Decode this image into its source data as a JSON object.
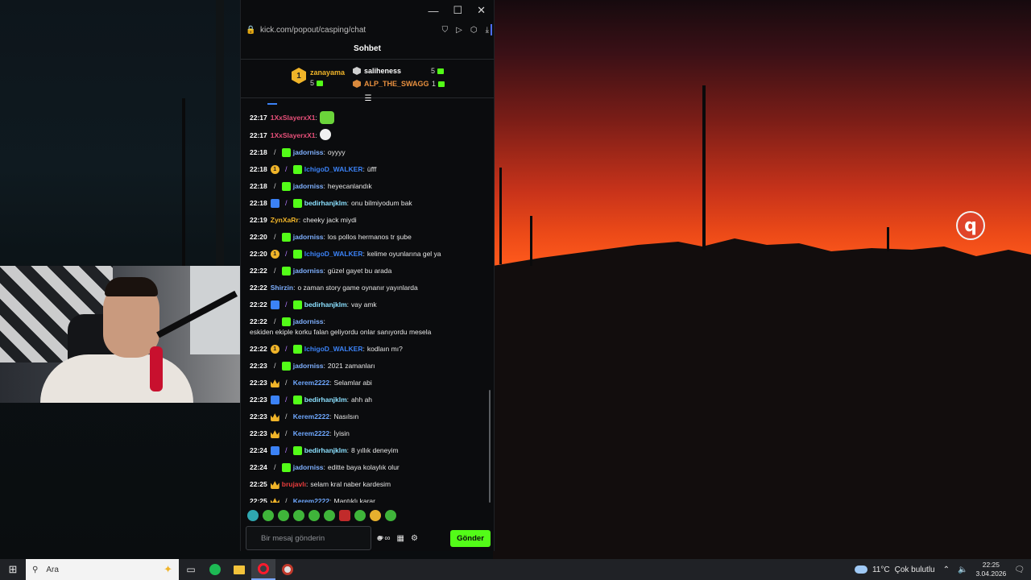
{
  "browser": {
    "url": "kick.com/popout/casping/chat"
  },
  "chat": {
    "title": "Sohbet",
    "leaderboard": [
      {
        "rank": "1",
        "name": "zanayama",
        "count": "5"
      },
      {
        "name": "saliheness",
        "count": "5"
      },
      {
        "name": "ALP_THE_SWAGG",
        "count": "1"
      }
    ],
    "messages": [
      {
        "time": "22:17",
        "user": "1XxSlayerxX1",
        "color": "#e8507a",
        "text": "",
        "emote": "green"
      },
      {
        "time": "22:17",
        "user": "1XxSlayerxX1",
        "color": "#e8507a",
        "text": "",
        "emote": "white"
      },
      {
        "time": "22:18",
        "badges": [
          "pen",
          "sub"
        ],
        "user": "jadorniss",
        "color": "#7fb0ff",
        "text": "oyyyy"
      },
      {
        "time": "22:18",
        "badges": [
          "coin",
          "pen-purple",
          "sub"
        ],
        "user": "IchigoD_WALKER",
        "color": "#3b82f6",
        "text": "üfff"
      },
      {
        "time": "22:18",
        "badges": [
          "pen",
          "sub"
        ],
        "user": "jadorniss",
        "color": "#7fb0ff",
        "text": "heyecanlandık"
      },
      {
        "time": "22:18",
        "badges": [
          "blue",
          "pen-purple",
          "sub"
        ],
        "user": "bedirhanjklm",
        "color": "#8be0ff",
        "text": "onu bilmiyodum bak"
      },
      {
        "time": "22:19",
        "badges": [],
        "user": "ZynXaRr",
        "color": "#f0b429",
        "text": "cheeky jack miydi"
      },
      {
        "time": "22:20",
        "badges": [
          "pen",
          "sub"
        ],
        "user": "jadorniss",
        "color": "#7fb0ff",
        "text": "los pollos hermanos tr şube"
      },
      {
        "time": "22:20",
        "badges": [
          "coin",
          "pen-purple",
          "sub"
        ],
        "user": "IchigoD_WALKER",
        "color": "#3b82f6",
        "text": "kelime oyunlarına gel ya"
      },
      {
        "time": "22:22",
        "badges": [
          "pen",
          "sub"
        ],
        "user": "jadorniss",
        "color": "#7fb0ff",
        "text": "güzel gayet bu arada"
      },
      {
        "time": "22:22",
        "badges": [],
        "user": "Shirzin",
        "color": "#7fb0ff",
        "text": "o zaman story game oynanır yayınlarda"
      },
      {
        "time": "22:22",
        "badges": [
          "blue",
          "pen-purple",
          "sub"
        ],
        "user": "bedirhanjklm",
        "color": "#8be0ff",
        "text": "vay amk"
      },
      {
        "time": "22:22",
        "badges": [
          "pen",
          "sub"
        ],
        "user": "jadorniss",
        "color": "#7fb0ff",
        "text": "eskiden ekiple korku falan geliyordu onlar sanıyordu mesela"
      },
      {
        "time": "22:22",
        "badges": [
          "coin",
          "pen-purple",
          "sub"
        ],
        "user": "IchigoD_WALKER",
        "color": "#3b82f6",
        "text": "kodlaın mı?"
      },
      {
        "time": "22:23",
        "badges": [
          "pen",
          "sub"
        ],
        "user": "jadorniss",
        "color": "#7fb0ff",
        "text": "2021 zamanları"
      },
      {
        "time": "22:23",
        "badges": [
          "crown",
          "pen"
        ],
        "user": "Kerem2222",
        "color": "#6fa8ff",
        "text": "Selamlar abi"
      },
      {
        "time": "22:23",
        "badges": [
          "blue",
          "pen-purple",
          "sub"
        ],
        "user": "bedirhanjklm",
        "color": "#8be0ff",
        "text": "ahh ah"
      },
      {
        "time": "22:23",
        "badges": [
          "crown",
          "pen"
        ],
        "user": "Kerem2222",
        "color": "#6fa8ff",
        "text": "Nasılsın"
      },
      {
        "time": "22:23",
        "badges": [
          "crown",
          "pen"
        ],
        "user": "Kerem2222",
        "color": "#6fa8ff",
        "text": "İyisin"
      },
      {
        "time": "22:24",
        "badges": [
          "blue",
          "pen-purple",
          "sub"
        ],
        "user": "bedirhanjklm",
        "color": "#8be0ff",
        "text": "8 yıllık deneyim"
      },
      {
        "time": "22:24",
        "badges": [
          "pen",
          "sub"
        ],
        "user": "jadorniss",
        "color": "#7fb0ff",
        "text": "editte baya kolaylık olur"
      },
      {
        "time": "22:25",
        "badges": [
          "crown"
        ],
        "user": "brujavlı",
        "color": "#e83c3c",
        "text": "selam kral naber kardesim"
      },
      {
        "time": "22:25",
        "badges": [
          "crown",
          "pen"
        ],
        "user": "Kerem2222",
        "color": "#6fa8ff",
        "text": "Mantıklı karar"
      }
    ],
    "input": {
      "placeholder": "Bir mesaj gönderin",
      "value": ""
    },
    "send_label": "Gönder"
  },
  "taskbar": {
    "search_placeholder": "Ara",
    "weather_temp": "11°C",
    "weather_desc": "Çok bulutlu",
    "time": "22:25",
    "date": "3.04.2026"
  },
  "colors": {
    "accent": "#53fc18",
    "chat_bg": "#0b0c0e"
  }
}
